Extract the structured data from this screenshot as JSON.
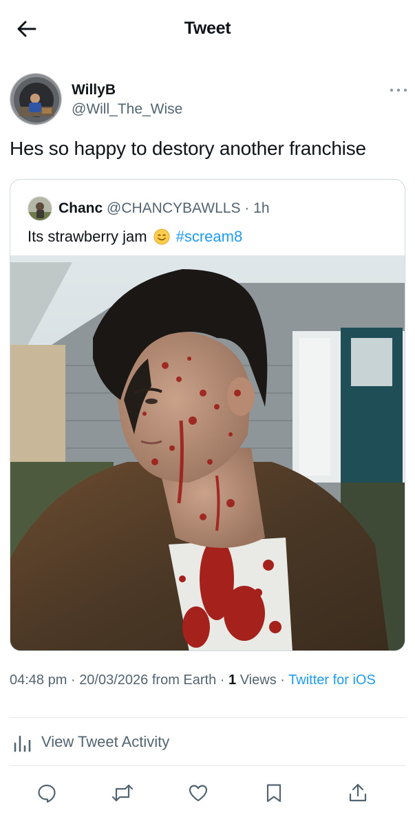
{
  "header": {
    "title": "Tweet",
    "back_icon": "arrow-left-icon"
  },
  "tweet": {
    "author": {
      "display_name": "WillyB",
      "handle": "@Will_The_Wise"
    },
    "text": "Hes so happy to destory another franchise",
    "quoted": {
      "display_name": "Chanc",
      "handle": "@CHANCYBAWLLS",
      "separator": "·",
      "time": "1h",
      "text": "Its strawberry jam",
      "emoji": "smiling-face-emoji",
      "hashtag": "#scream8"
    },
    "meta": {
      "time": "04:48 pm",
      "separator": "·",
      "date": "20/03/2026",
      "location": "from Earth",
      "views_count": "1",
      "views_label": "Views",
      "client": "Twitter for iOS"
    },
    "activity_label": "View Tweet Activity"
  },
  "actions": [
    "reply-icon",
    "retweet-icon",
    "like-icon",
    "bookmark-icon",
    "share-icon"
  ],
  "colors": {
    "accent": "#1d9bf0",
    "text_primary": "#0f1419",
    "text_secondary": "#536471",
    "border": "#cfd9de"
  }
}
